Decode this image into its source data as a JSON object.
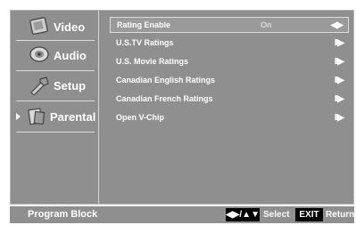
{
  "sidebar": {
    "items": [
      {
        "label": "Video",
        "icon": "video-icon"
      },
      {
        "label": "Audio",
        "icon": "audio-icon"
      },
      {
        "label": "Setup",
        "icon": "setup-icon"
      },
      {
        "label": "Parental",
        "icon": "parental-icon",
        "active": true
      }
    ]
  },
  "menu": {
    "rows": [
      {
        "label": "Rating Enable",
        "value": "On",
        "control": "◀▶",
        "selected": true
      },
      {
        "label": "U.S.TV Ratings",
        "control": "II▶"
      },
      {
        "label": "U.S. Movie Ratings",
        "control": "II▶"
      },
      {
        "label": "Canadian English Ratings",
        "control": "II▶"
      },
      {
        "label": "Canadian French Ratings",
        "control": "II▶"
      },
      {
        "label": "Open V-Chip",
        "control": "II▶"
      }
    ]
  },
  "footer": {
    "title": "Program Block",
    "nav_key": "◀▶/▲▼",
    "select_label": "Select",
    "exit_key": "EXIT",
    "return_label": "Return"
  },
  "colors": {
    "panel": "#8f8f8f",
    "border": "#dcdcdc",
    "text": "#ffffff"
  }
}
